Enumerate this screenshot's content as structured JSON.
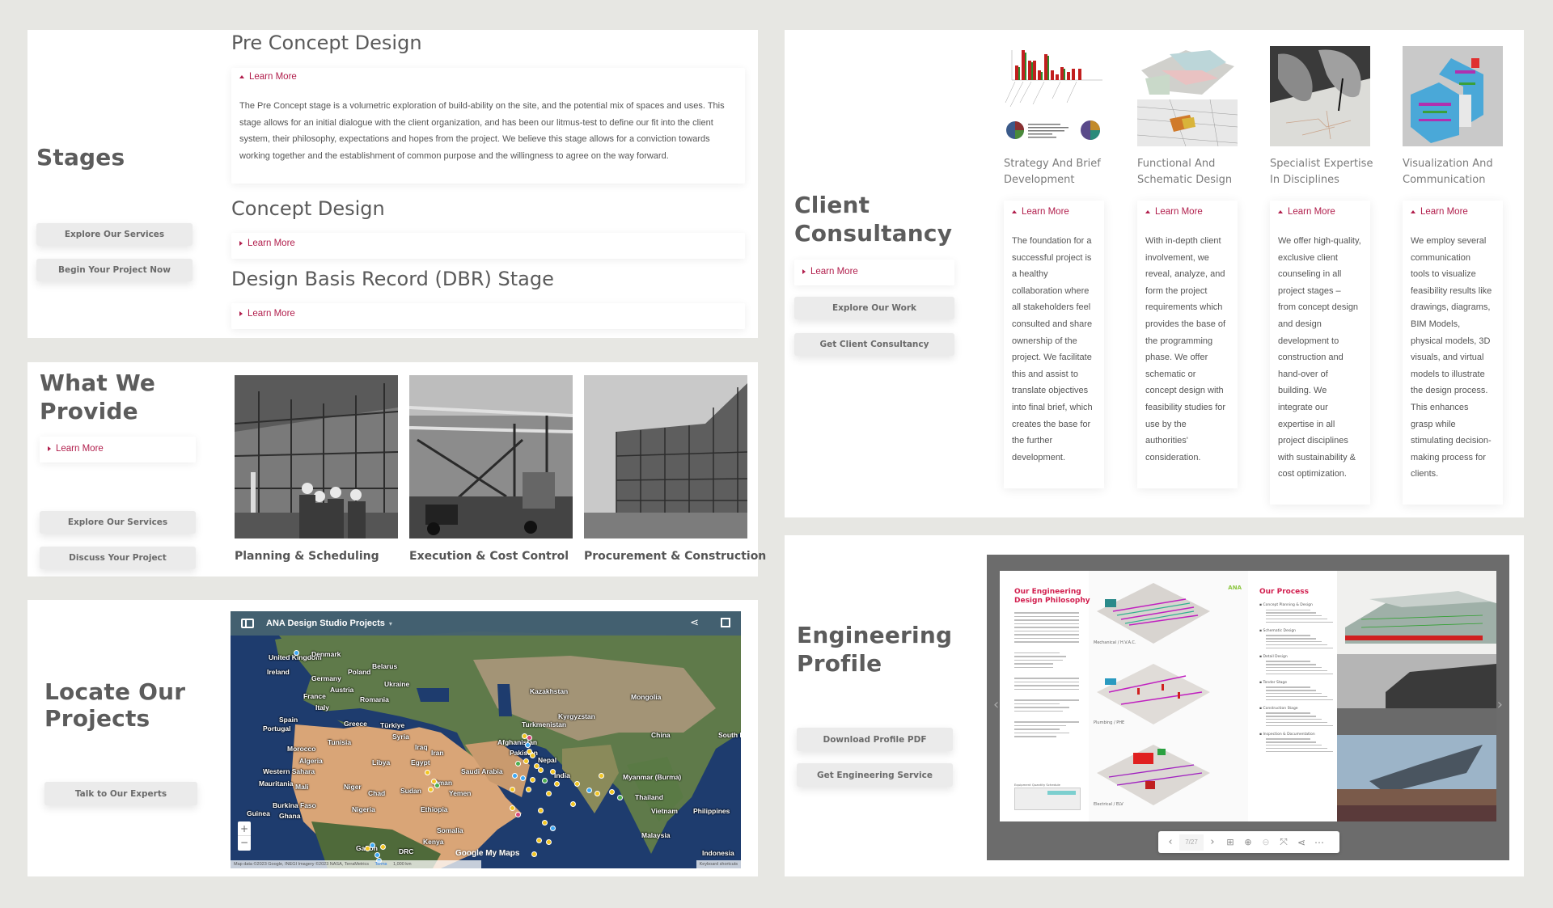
{
  "colors": {
    "accent": "#b11e4c",
    "background": "#e7e7e3",
    "heading": "#5c5c5c",
    "button_bg": "#ebebeb",
    "map_header": "#4a6572"
  },
  "stages": {
    "heading": "Stages",
    "buttons": [
      "Explore Our Services",
      "Begin Your Project Now"
    ],
    "items": [
      {
        "title": "Pre Concept Design",
        "learn_more": "Learn More",
        "expanded": true,
        "body": "The Pre Concept stage is a volumetric exploration of build-ability on the site, and the potential mix of spaces and uses. This stage allows for an initial dialogue with the client organization, and has been our litmus-test to define our fit into the client system, their philosophy, expectations and hopes from the project. We believe this stage allows for a conviction towards working together and the establishment of common purpose and the willingness to agree on the way forward."
      },
      {
        "title": "Concept Design",
        "learn_more": "Learn More",
        "expanded": false
      },
      {
        "title": "Design Basis Record (DBR) Stage",
        "learn_more": "Learn More",
        "expanded": false
      }
    ]
  },
  "what_we_provide": {
    "heading_line1": "What We",
    "heading_line2": "Provide",
    "learn_more": "Learn More",
    "buttons": [
      "Explore Our Services",
      "Discuss Your Project"
    ],
    "items": [
      {
        "caption": "Planning & Scheduling",
        "image": "construction-site-workers-photo"
      },
      {
        "caption": "Execution & Cost Control",
        "image": "industrial-interior-photo"
      },
      {
        "caption": "Procurement & Construction",
        "image": "scaffolding-building-photo"
      }
    ]
  },
  "locate": {
    "heading_line1": "Locate Our",
    "heading_line2": "Projects",
    "button": "Talk to Our Experts",
    "map": {
      "title": "ANA Design Studio Projects",
      "zoom_in": "+",
      "zoom_out": "−",
      "branding": "Google My Maps",
      "attribution": "Map data ©2023 Google, INEGI Imagery ©2023 NASA, TerraMetrics",
      "terms": "Terms",
      "scale": "1,000 km",
      "keyboard": "Keyboard shortcuts",
      "labels": [
        "United Kingdom",
        "Denmark",
        "Ireland",
        "Belarus",
        "Poland",
        "Germany",
        "Ukraine",
        "Austria",
        "France",
        "Romania",
        "Italy",
        "Spain",
        "Portugal",
        "Greece",
        "Türkiye",
        "Kazakhstan",
        "Mongolia",
        "Kyrgyzstan",
        "Turkmenistan",
        "Tunisia",
        "Morocco",
        "Syria",
        "Iraq",
        "Iran",
        "Afghanistan",
        "Pakistan",
        "China",
        "South K",
        "Algeria",
        "Libya",
        "Egypt",
        "Western Sahara",
        "Saudi Arabia",
        "Oman",
        "Nepal",
        "India",
        "Myanmar (Burma)",
        "Mauritania",
        "Mali",
        "Niger",
        "Chad",
        "Sudan",
        "Yemen",
        "Thailand",
        "Burkina Faso",
        "Guinea",
        "Nigeria",
        "Ghana",
        "Ethiopia",
        "Vietnam",
        "Philippines",
        "Somalia",
        "Malaysia",
        "Kenya",
        "Gabon",
        "DRC",
        "Indonesia"
      ]
    }
  },
  "client_consultancy": {
    "heading_line1": "Client",
    "heading_line2": "Consultancy",
    "learn_more": "Learn More",
    "buttons": [
      "Explore Our Work",
      "Get Client Consultancy"
    ],
    "services": [
      {
        "title_line1": "Strategy And Brief",
        "title_line2": "Development",
        "image": "charts-graphs-image",
        "learn_more": "Learn More",
        "lines": [
          "The foundation for a",
          "successful project is",
          "a healthy",
          "collaboration where",
          "all stakeholders feel",
          "consulted and share",
          "ownership of the",
          "project. We facilitate",
          "this and assist to",
          "translate objectives",
          "into final brief, which",
          "creates the base for",
          "the further",
          "development."
        ]
      },
      {
        "title_line1": "Functional And",
        "title_line2": "Schematic Design",
        "image": "site-plan-3d-image",
        "learn_more": "Learn More",
        "lines": [
          "With in-depth client",
          "involvement, we",
          "reveal, analyze, and",
          "form the project",
          "requirements which",
          "provides the base of",
          "the programming",
          "phase. We offer",
          "schematic or",
          "concept design with",
          "feasibility studies for",
          "use by the",
          "authorities'",
          "consideration."
        ]
      },
      {
        "title_line1": "Specialist Expertise",
        "title_line2": "In Disciplines",
        "image": "hands-drawing-photo",
        "learn_more": "Learn More",
        "lines": [
          "We offer high-quality,",
          "exclusive client",
          "counseling in all",
          "project stages –",
          "from concept design",
          "and design",
          "development to",
          "construction and",
          "hand-over of",
          "building. We",
          "integrate our",
          "expertise in all",
          "project disciplines",
          "with sustainability &",
          "cost optimization."
        ]
      },
      {
        "title_line1": "Visualization And",
        "title_line2": "Communication",
        "image": "bim-model-image",
        "learn_more": "Learn More",
        "lines": [
          "We employ several",
          "communication",
          "tools to visualize",
          "feasibility results like",
          "drawings, diagrams,",
          "BIM Models,",
          "physical models, 3D",
          "visuals, and virtual",
          "models to illustrate",
          "the design process.",
          "This  enhances",
          "grasp while",
          "stimulating decision-",
          "making process for",
          "clients."
        ]
      }
    ]
  },
  "engineering_profile": {
    "heading_line1": "Engineering",
    "heading_line2": "Profile",
    "buttons": [
      "Download Profile PDF",
      "Get Engineering Service"
    ],
    "flipbook": {
      "left_page_title_line1": "Our Engineering",
      "left_page_title_line2": "Design Philosophy",
      "brand": "ANA",
      "systems": [
        "Mechanical / H.V.A.C.",
        "Plumbing / PHE",
        "Electrical / ELV"
      ],
      "equipment_schedule": "Equipment Quantity Schedule",
      "right_page_title": "Our Process",
      "process_steps": [
        "Concept Planning & Design",
        "Schematic Design",
        "Detail Design",
        "Tender Stage",
        "Construction Stage",
        "Inspection & Documentation"
      ],
      "page_indicator": "7/27",
      "toolbar": [
        "prev",
        "page",
        "next",
        "thumbnails",
        "zoom-in",
        "zoom-out",
        "fullscreen",
        "share",
        "more"
      ]
    }
  }
}
